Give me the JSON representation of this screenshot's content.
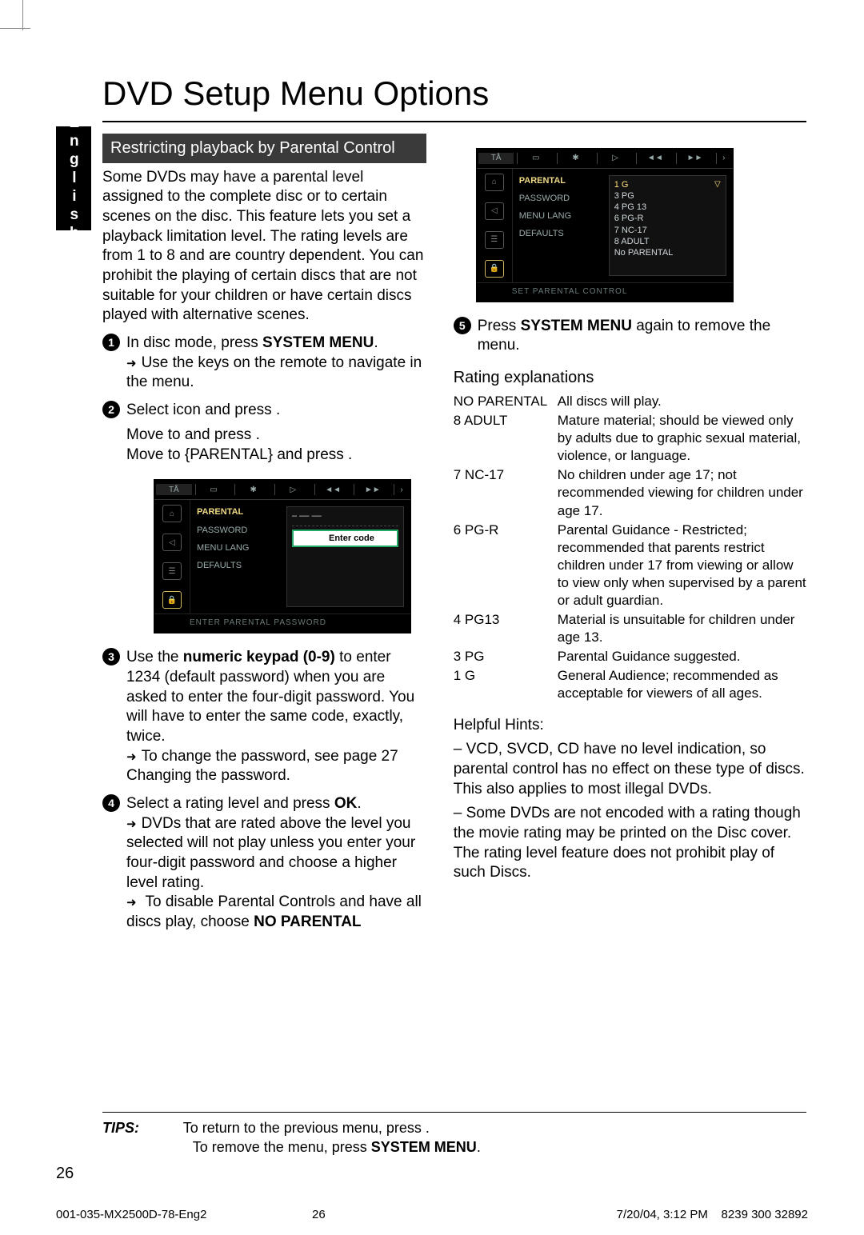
{
  "title": "DVD Setup Menu Options",
  "language_tab": "English",
  "section": {
    "header": "Restricting playback by Parental Control",
    "intro": "Some DVDs may have a parental level assigned to the complete disc or to certain scenes on the disc. This feature lets you set a playback limitation level. The rating levels are from 1 to 8 and are country dependent. You can prohibit the playing of certain discs that are not suitable for your children or have certain discs played with alternative scenes."
  },
  "steps": {
    "s1a_pre": "In disc mode, press ",
    "s1a_key": "SYSTEM MENU",
    "s1a_post": ".",
    "s1b": "Use the              keys on the remote to navigate in the menu.",
    "s2a": "Select      icon and press  .",
    "s2b": "Move to        and press  .",
    "s2c": "Move to {PARENTAL} and press .",
    "s3a_pre": "Use the ",
    "s3a_key": "numeric keypad (0-9)",
    "s3a_post": " to enter 1234 (default password) when you are asked to enter the four-digit password. You will have to enter the same code, exactly, twice.",
    "s3b": "To change the password, see page 27 Changing the password.",
    "s4a_pre": "Select a rating level and press ",
    "s4a_key": "OK",
    "s4a_post": ".",
    "s4b": "DVDs that are rated above the level you selected will not play unless you enter your four-digit password and choose a higher level rating.",
    "s4c_pre": "To disable Parental Controls and have all discs play, choose ",
    "s4c_key": "NO PARENTAL",
    "s5_pre": "Press ",
    "s5_key": "SYSTEM MENU",
    "s5_post": " again to remove the menu."
  },
  "osd_common": {
    "menu_items": [
      "PARENTAL",
      "PASSWORD",
      "MENU LANG",
      "DEFAULTS"
    ]
  },
  "osd1": {
    "right_label": "Enter code",
    "footer": "ENTER PARENTAL PASSWORD"
  },
  "osd2": {
    "options": [
      "1 G",
      "3 PG",
      "4 PG 13",
      "6 PG-R",
      "7 NC-17",
      "8 ADULT",
      "No PARENTAL"
    ],
    "footer": "SET PARENTAL CONTROL"
  },
  "ratings": {
    "heading": "Rating explanations",
    "items": [
      {
        "label": "NO PARENTAL",
        "desc": "All discs will play."
      },
      {
        "label": "8 ADULT",
        "desc": "Mature material; should be viewed only by adults due to graphic sexual material, violence, or language."
      },
      {
        "label": "7 NC-17",
        "desc": "No children under age 17; not recommended viewing for children under age 17."
      },
      {
        "label": "6 PG-R",
        "desc": "Parental Guidance - Restricted; recommended that parents restrict children under 17 from viewing or allow to view only when supervised by a parent or adult guardian."
      },
      {
        "label": "4 PG13",
        "desc": "Material is unsuitable for children under age 13."
      },
      {
        "label": "3 PG",
        "desc": "Parental Guidance suggested."
      },
      {
        "label": "1 G",
        "desc": "General Audience; recommended as acceptable for viewers of all ages."
      }
    ]
  },
  "hints": {
    "heading": "Helpful Hints:",
    "h1": "– VCD, SVCD, CD have no level indication, so parental control has no effect on these type of discs. This also applies to most illegal DVDs.",
    "h2": "– Some DVDs are not encoded with a rating though the movie rating may be printed on the Disc cover. The rating level feature does not prohibit play of such Discs."
  },
  "tips": {
    "label": "TIPS:",
    "line1_pre": "To return to the previous menu, press    .",
    "line2_pre": "To remove the menu, press ",
    "line2_key": "SYSTEM MENU",
    "line2_post": "."
  },
  "page_number": "26",
  "footer": {
    "left": "001-035-MX2500D-78-Eng2",
    "mid": "26",
    "right_date": "7/20/04, 3:12 PM",
    "right_code": "8239 300 32892"
  }
}
